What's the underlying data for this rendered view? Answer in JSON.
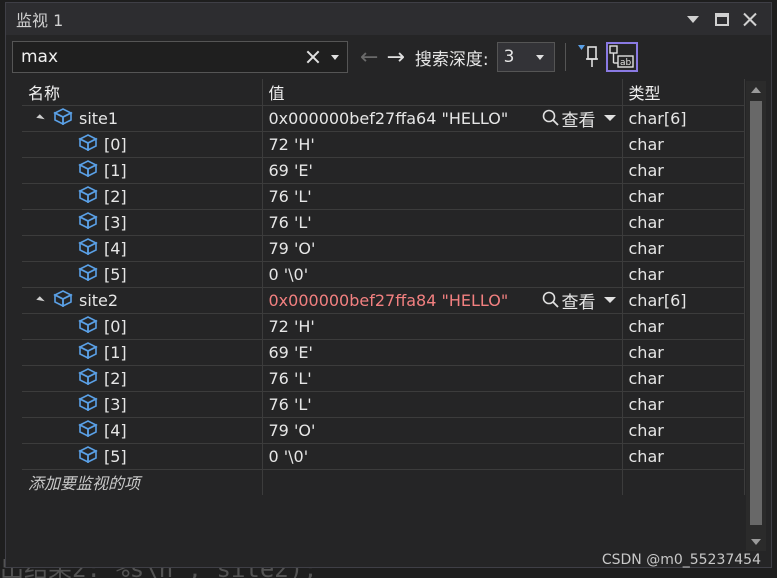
{
  "window": {
    "title": "监视 1"
  },
  "toolbar": {
    "search_value": "max",
    "depth_label": "搜索深度:",
    "depth_value": "3"
  },
  "columns": {
    "name": "名称",
    "value": "值",
    "type": "类型"
  },
  "rows": [
    {
      "name": "site1",
      "value": "0x000000bef27ffa64 \"HELLO\"",
      "view": "查看",
      "type": "char[6]",
      "children": [
        {
          "name": "[0]",
          "value": "72 'H'",
          "type": "char"
        },
        {
          "name": "[1]",
          "value": "69 'E'",
          "type": "char"
        },
        {
          "name": "[2]",
          "value": "76 'L'",
          "type": "char"
        },
        {
          "name": "[3]",
          "value": "76 'L'",
          "type": "char"
        },
        {
          "name": "[4]",
          "value": "79 'O'",
          "type": "char"
        },
        {
          "name": "[5]",
          "value": "0 '\\0'",
          "type": "char"
        }
      ]
    },
    {
      "name": "site2",
      "value": "0x000000bef27ffa84 \"HELLO\"",
      "view": "查看",
      "type": "char[6]",
      "value_color": "#f28080",
      "children": [
        {
          "name": "[0]",
          "value": "72 'H'",
          "type": "char"
        },
        {
          "name": "[1]",
          "value": "69 'E'",
          "type": "char"
        },
        {
          "name": "[2]",
          "value": "76 'L'",
          "type": "char"
        },
        {
          "name": "[3]",
          "value": "76 'L'",
          "type": "char"
        },
        {
          "name": "[4]",
          "value": "79 'O'",
          "type": "char"
        },
        {
          "name": "[5]",
          "value": "0 '\\0'",
          "type": "char"
        }
      ]
    }
  ],
  "add_item": "添加要监视的项",
  "editor_snippet": "出结果2: %s\\n\", site2);",
  "watermark": "CSDN @m0_55237454",
  "colors": {
    "accent": "#8a7ae3",
    "changed_value": "#f28080",
    "icon_blue": "#5aa0e6"
  }
}
